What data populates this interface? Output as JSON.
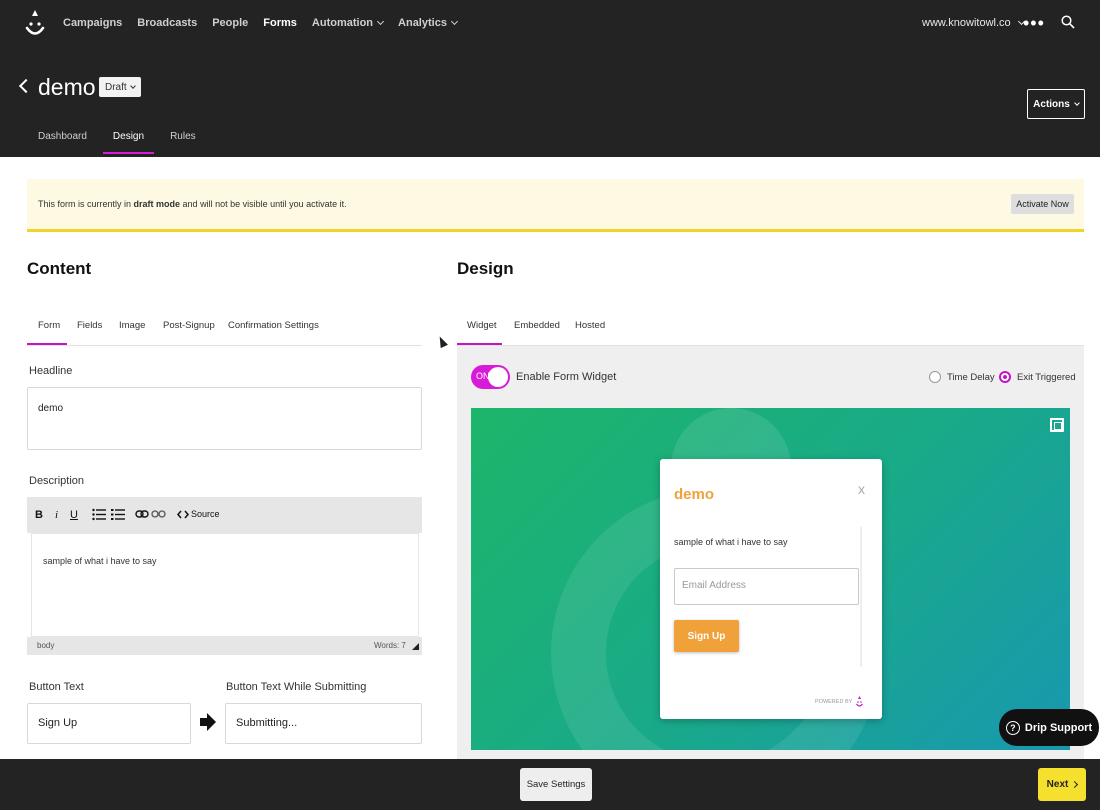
{
  "nav": {
    "items": [
      "Campaigns",
      "Broadcasts",
      "People",
      "Forms",
      "Automation",
      "Analytics"
    ],
    "account": "www.knowitowl.co",
    "more_icon": "more-dots-icon",
    "search_icon": "search-icon"
  },
  "form": {
    "title": "demo",
    "status": "Draft",
    "actions_label": "Actions",
    "tabs": [
      "Dashboard",
      "Design",
      "Rules"
    ]
  },
  "banner": {
    "text_before": "This form is currently in ",
    "text_bold": "draft mode",
    "text_after": " and will not be visible until you activate it.",
    "activate_label": "Activate Now"
  },
  "content": {
    "heading": "Content",
    "tabs": [
      "Form",
      "Fields",
      "Image",
      "Post-Signup",
      "Confirmation Settings"
    ],
    "headline_label": "Headline",
    "headline_value": "demo",
    "description_label": "Description",
    "toolbar": {
      "bold": "B",
      "italic": "i",
      "underline": "U",
      "source": "Source"
    },
    "description_value": "sample of what i have to say",
    "editor_path": "body",
    "word_count": "Words: 7",
    "button_text_label": "Button Text",
    "button_text_value": "Sign Up",
    "submitting_label": "Button Text While Submitting",
    "submitting_value": "Submitting..."
  },
  "design": {
    "heading": "Design",
    "tabs": [
      "Widget",
      "Embedded",
      "Hosted"
    ],
    "toggle_state": "ON",
    "enable_label": "Enable Form Widget",
    "trigger_options": [
      "Time Delay",
      "Exit Triggered"
    ],
    "selected_trigger": "Exit Triggered",
    "preview": {
      "title": "demo",
      "close": "x",
      "description": "sample of what i have to say",
      "email_placeholder": "Email Address",
      "button": "Sign Up",
      "powered_by": "POWERED BY"
    }
  },
  "support_label": "Drip Support",
  "footer": {
    "save_label": "Save Settings",
    "next_label": "Next"
  },
  "colors": {
    "accent": "#d81bd8",
    "banner_border": "#f1d32a",
    "preview_button": "#f0a13a",
    "next_button": "#f5e02e"
  }
}
